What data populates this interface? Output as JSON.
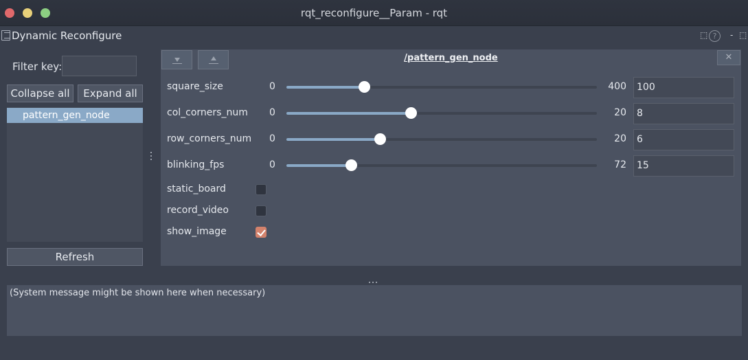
{
  "window": {
    "title": "rqt_reconfigure__Param - rqt"
  },
  "dock": {
    "title": "Dynamic Reconfigure",
    "ctrl_undock": "⬚",
    "ctrl_help": "?",
    "ctrl_min": "-",
    "ctrl_close": "⬚"
  },
  "sidebar": {
    "filter_label": "Filter key:",
    "filter_value": "",
    "collapse_label": "Collapse all",
    "expand_label": "Expand all",
    "tree_items": [
      "pattern_gen_node"
    ],
    "refresh_label": "Refresh"
  },
  "node": {
    "title": "/pattern_gen_node",
    "close_label": "✕",
    "sliders": [
      {
        "name": "square_size",
        "min": "0",
        "max": "400",
        "value": "100",
        "fraction": 0.25
      },
      {
        "name": "col_corners_num",
        "min": "0",
        "max": "20",
        "value": "8",
        "fraction": 0.4
      },
      {
        "name": "row_corners_num",
        "min": "0",
        "max": "20",
        "value": "6",
        "fraction": 0.3
      },
      {
        "name": "blinking_fps",
        "min": "0",
        "max": "72",
        "value": "15",
        "fraction": 0.2083
      }
    ],
    "checkboxes": [
      {
        "name": "static_board",
        "checked": false
      },
      {
        "name": "record_video",
        "checked": false
      },
      {
        "name": "show_image",
        "checked": true
      }
    ]
  },
  "messages": {
    "text": "(System message might be shown here when necessary)"
  },
  "colors": {
    "accent": "#8aa9c7",
    "checkbox_on": "#d3826c",
    "background": "#3a404d"
  }
}
